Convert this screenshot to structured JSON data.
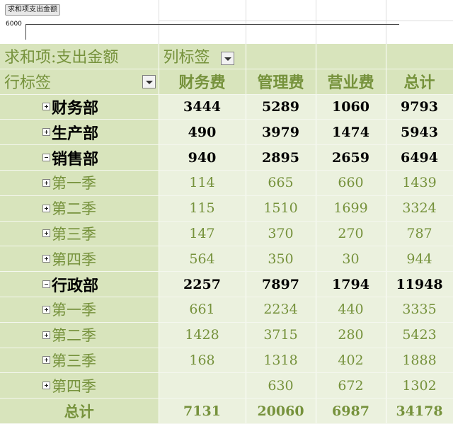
{
  "field_button": "求和项支出金额",
  "axis": {
    "label": "6000"
  },
  "pivot": {
    "value_field": "求和项:支出金额",
    "col_labels": "列标签",
    "row_labels": "行标签",
    "columns": [
      "财务费",
      "管理费",
      "营业费",
      "总计"
    ],
    "rows": [
      {
        "label": "财务部",
        "level": 0,
        "toggle": "plus",
        "values": [
          "3444",
          "5289",
          "1060",
          "9793"
        ]
      },
      {
        "label": "生产部",
        "level": 0,
        "toggle": "plus",
        "values": [
          "490",
          "3979",
          "1474",
          "5943"
        ]
      },
      {
        "label": "销售部",
        "level": 0,
        "toggle": "minus",
        "values": [
          "940",
          "2895",
          "2659",
          "6494"
        ]
      },
      {
        "label": "第一季",
        "level": 1,
        "toggle": "plus",
        "values": [
          "114",
          "665",
          "660",
          "1439"
        ]
      },
      {
        "label": "第二季",
        "level": 1,
        "toggle": "plus",
        "values": [
          "115",
          "1510",
          "1699",
          "3324"
        ]
      },
      {
        "label": "第三季",
        "level": 1,
        "toggle": "plus",
        "values": [
          "147",
          "370",
          "270",
          "787"
        ]
      },
      {
        "label": "第四季",
        "level": 1,
        "toggle": "plus",
        "values": [
          "564",
          "350",
          "30",
          "944"
        ]
      },
      {
        "label": "行政部",
        "level": 0,
        "toggle": "minus",
        "values": [
          "2257",
          "7897",
          "1794",
          "11948"
        ]
      },
      {
        "label": "第一季",
        "level": 1,
        "toggle": "plus",
        "values": [
          "661",
          "2234",
          "440",
          "3335"
        ]
      },
      {
        "label": "第二季",
        "level": 1,
        "toggle": "plus",
        "values": [
          "1428",
          "3715",
          "280",
          "5423"
        ]
      },
      {
        "label": "第三季",
        "level": 1,
        "toggle": "plus",
        "values": [
          "168",
          "1318",
          "402",
          "1888"
        ]
      },
      {
        "label": "第四季",
        "level": 1,
        "toggle": "plus",
        "values": [
          "",
          "630",
          "672",
          "1302"
        ]
      }
    ],
    "total": {
      "label": "总计",
      "values": [
        "7131",
        "20060",
        "6987",
        "34178"
      ]
    }
  },
  "colors": {
    "header_bg": "#d8e4bc",
    "cell_bg": "#ebf1de",
    "accent_text": "#76923c"
  }
}
